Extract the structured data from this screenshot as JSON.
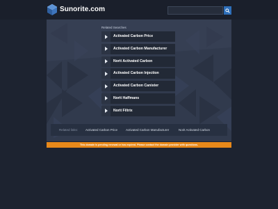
{
  "header": {
    "site_name": "Sunorite.com",
    "search_placeholder": "",
    "search_icon": "search-icon",
    "logo_icon": "cube-logo-icon"
  },
  "main": {
    "related_heading": "Related Searches",
    "links": [
      {
        "label": "Activated Carbon Price"
      },
      {
        "label": "Activated Carbon Manufacturer"
      },
      {
        "label": "Norit Activated Carbon"
      },
      {
        "label": "Activated Carbon Injection"
      },
      {
        "label": "Activated Carbon Canister"
      },
      {
        "label": "Norit Haffmans"
      },
      {
        "label": "Norit Filtrix"
      }
    ],
    "bottom_bar": {
      "label": "Related links:",
      "links": [
        "Activated Carbon Price",
        "Activated Carbon Manufacturer",
        "Norit Activated Carbon"
      ]
    }
  },
  "notice": "This domain is pending renewal or has expired. Please contact the domain provider with questions.",
  "colors": {
    "background": "#1d2330",
    "panel": "#313a4d",
    "link_box": "#222936",
    "notice": "#e8891a",
    "search_button": "#2e6fba",
    "logo": "#3c6fb3"
  }
}
